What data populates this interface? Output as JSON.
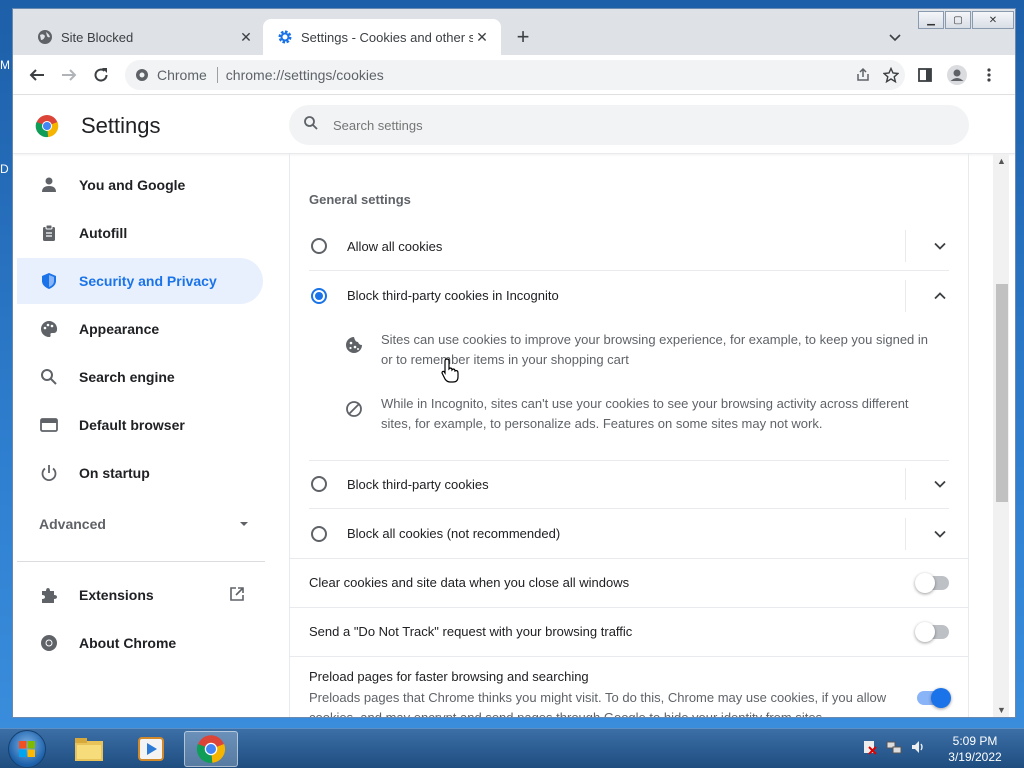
{
  "desktop": {
    "edge_top": "M",
    "edge_mid": "D"
  },
  "tabs": [
    {
      "title": "Site Blocked",
      "icon": "globe-icon",
      "active": false
    },
    {
      "title": "Settings - Cookies and other site",
      "icon": "gear-icon",
      "active": true
    }
  ],
  "omnibox": {
    "site_label": "Chrome",
    "url": "chrome://settings/cookies"
  },
  "settings": {
    "title": "Settings",
    "search_placeholder": "Search settings",
    "nav": [
      {
        "label": "You and Google",
        "icon": "person-icon"
      },
      {
        "label": "Autofill",
        "icon": "clipboard-icon"
      },
      {
        "label": "Security and Privacy",
        "icon": "shield-icon",
        "selected": true
      },
      {
        "label": "Appearance",
        "icon": "palette-icon"
      },
      {
        "label": "Search engine",
        "icon": "search-icon"
      },
      {
        "label": "Default browser",
        "icon": "browser-icon"
      },
      {
        "label": "On startup",
        "icon": "power-icon"
      }
    ],
    "advanced_label": "Advanced",
    "extensions_label": "Extensions",
    "about_label": "About Chrome"
  },
  "cookies": {
    "section_title": "General settings",
    "options": [
      {
        "label": "Allow all cookies",
        "selected": false
      },
      {
        "label": "Block third-party cookies in Incognito",
        "selected": true
      },
      {
        "label": "Block third-party cookies",
        "selected": false
      },
      {
        "label": "Block all cookies (not recommended)",
        "selected": false
      }
    ],
    "details": [
      "Sites can use cookies to improve your browsing experience, for example, to keep you signed in or to remember items in your shopping cart",
      "While in Incognito, sites can't use your cookies to see your browsing activity across different sites, for example, to personalize ads. Features on some sites may not work."
    ],
    "toggles": [
      {
        "label": "Clear cookies and site data when you close all windows",
        "on": false
      },
      {
        "label": "Send a \"Do Not Track\" request with your browsing traffic",
        "on": false
      }
    ],
    "preload": {
      "title": "Preload pages for faster browsing and searching",
      "description": "Preloads pages that Chrome thinks you might visit. To do this, Chrome may use cookies, if you allow cookies, and may encrypt and send pages through Google to hide your identity from sites.",
      "on": true
    }
  },
  "taskbar": {
    "time": "5:09 PM",
    "date": "3/19/2022"
  },
  "colors": {
    "accent": "#1a73e8",
    "selected_bg": "#e8f0fe"
  }
}
